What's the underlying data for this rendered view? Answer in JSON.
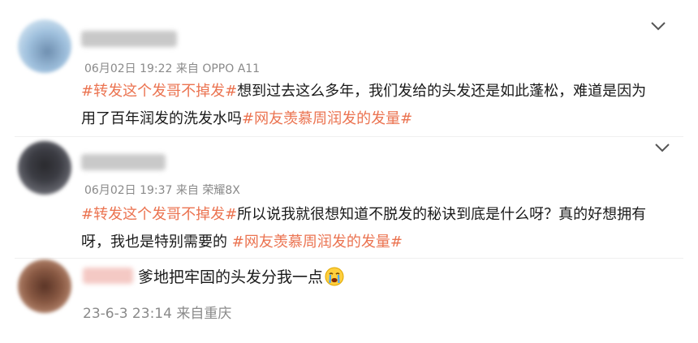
{
  "comments": [
    {
      "meta": "06月02日 19:22  来自 OPPO A11",
      "tag1": "#转发这个发哥不掉发#",
      "line1_rest": "想到过去这么多年，我们发给的头发还是如此蓬松，难道是因为",
      "line2_text": "用了百年润发的洗发水吗",
      "tag2": "#网友羡慕周润发的发量#",
      "chevron_icon": "chevron-down-icon"
    },
    {
      "meta": "06月02日 19:37  来自 荣耀8X",
      "tag1": "#转发这个发哥不掉发#",
      "line1_rest": "所以说我就很想知道不脱发的秘诀到底是什么呀？真的好想拥有",
      "line2_text": "呀，我也是特别需要的 ",
      "tag2": "#网友羡慕周润发的发量#",
      "chevron_icon": "chevron-down-icon"
    },
    {
      "text": "爹地把牢固的头发分我一点",
      "emoji_icon": "crying-face-icon",
      "meta": "23-6-3 23:14 来自重庆"
    }
  ],
  "colors": {
    "tag": "#eb7350",
    "meta": "#8a8a8a",
    "text": "#1a1a1a"
  }
}
